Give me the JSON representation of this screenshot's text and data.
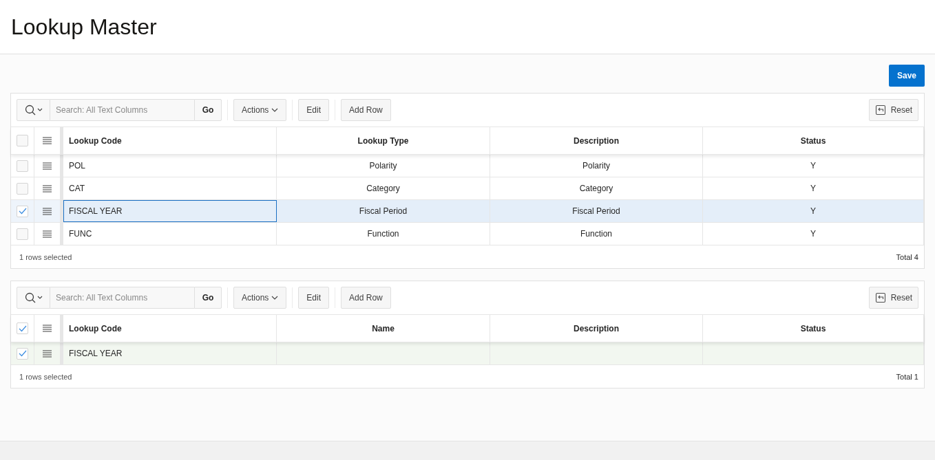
{
  "page": {
    "title": "Lookup Master"
  },
  "save_button": "Save",
  "grids": [
    {
      "toolbar": {
        "search_placeholder": "Search: All Text Columns",
        "go": "Go",
        "actions": "Actions",
        "edit": "Edit",
        "add_row": "Add Row",
        "reset": "Reset"
      },
      "all_selected": false,
      "columns": [
        "Lookup Code",
        "Lookup Type",
        "Description",
        "Status"
      ],
      "rows": [
        {
          "selected": false,
          "inserted": false,
          "focused": false,
          "cells": [
            "POL",
            "Polarity",
            "Polarity",
            "Y"
          ]
        },
        {
          "selected": false,
          "inserted": false,
          "focused": false,
          "cells": [
            "CAT",
            "Category",
            "Category",
            "Y"
          ]
        },
        {
          "selected": true,
          "inserted": false,
          "focused": true,
          "cells": [
            "FISCAL YEAR",
            "Fiscal Period",
            "Fiscal Period",
            "Y"
          ]
        },
        {
          "selected": false,
          "inserted": false,
          "focused": false,
          "cells": [
            "FUNC",
            "Function",
            "Function",
            "Y"
          ]
        }
      ],
      "footer": {
        "selection": "1 rows selected",
        "total": "Total 4"
      }
    },
    {
      "toolbar": {
        "search_placeholder": "Search: All Text Columns",
        "go": "Go",
        "actions": "Actions",
        "edit": "Edit",
        "add_row": "Add Row",
        "reset": "Reset"
      },
      "all_selected": true,
      "columns": [
        "Lookup Code",
        "Name",
        "Description",
        "Status"
      ],
      "rows": [
        {
          "selected": true,
          "inserted": true,
          "focused": false,
          "cells": [
            "FISCAL YEAR"
          ]
        }
      ],
      "footer": {
        "selection": "1 rows selected",
        "total": "Total 1"
      }
    }
  ]
}
